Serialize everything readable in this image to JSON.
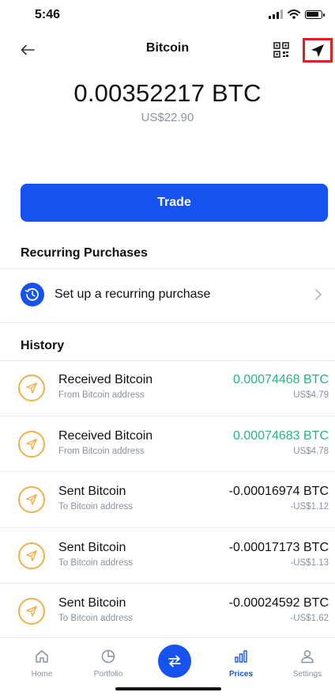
{
  "status_bar": {
    "time": "5:46"
  },
  "header": {
    "title": "Bitcoin",
    "back_icon": "arrow-left-icon",
    "qr_icon": "qr-code-icon",
    "send_icon": "send-arrow-icon",
    "highlight_color": "#e01e26"
  },
  "balance": {
    "crypto": "0.00352217 BTC",
    "fiat": "US$22.90"
  },
  "trade": {
    "label": "Trade",
    "color": "#1652f0"
  },
  "recurring": {
    "section_title": "Recurring Purchases",
    "label": "Set up a recurring purchase",
    "icon": "recurring-clock-icon"
  },
  "history": {
    "section_title": "History",
    "items": [
      {
        "title": "Received Bitcoin",
        "subtitle": "From Bitcoin address",
        "amount": "0.00074468 BTC",
        "fiat": "US$4.79",
        "direction": "in"
      },
      {
        "title": "Received Bitcoin",
        "subtitle": "From Bitcoin address",
        "amount": "0.00074683 BTC",
        "fiat": "US$4.78",
        "direction": "in"
      },
      {
        "title": "Sent Bitcoin",
        "subtitle": "To Bitcoin address",
        "amount": "-0.00016974 BTC",
        "fiat": "-US$1.12",
        "direction": "out"
      },
      {
        "title": "Sent Bitcoin",
        "subtitle": "To Bitcoin address",
        "amount": "-0.00017173 BTC",
        "fiat": "-US$1.13",
        "direction": "out"
      },
      {
        "title": "Sent Bitcoin",
        "subtitle": "To Bitcoin address",
        "amount": "-0.00024592 BTC",
        "fiat": "-US$1.62",
        "direction": "out"
      }
    ],
    "positive_color": "#2bb38a",
    "icon_color": "#f2b04b"
  },
  "bottom_nav": {
    "items": [
      {
        "label": "Home",
        "icon": "home-icon"
      },
      {
        "label": "Portfolio",
        "icon": "pie-chart-icon"
      },
      {
        "label": "Prices",
        "icon": "bar-chart-icon",
        "active": true
      },
      {
        "label": "Settings",
        "icon": "person-icon"
      }
    ],
    "center_icon": "swap-arrows-icon"
  }
}
